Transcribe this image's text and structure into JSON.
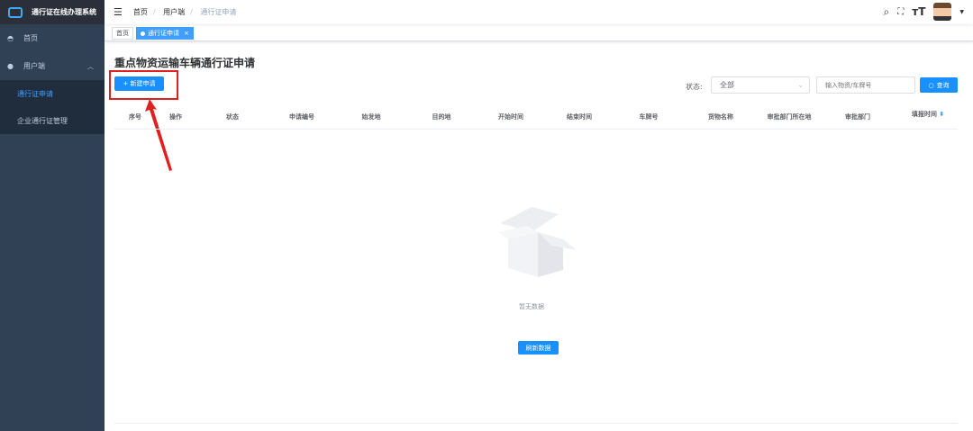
{
  "app": {
    "title": "通行证在线办理系统"
  },
  "sidebar": {
    "items": [
      {
        "label": "首页"
      },
      {
        "label": "用户端",
        "children": [
          {
            "label": "通行证申请",
            "active": true
          },
          {
            "label": "企业通行证管理"
          }
        ]
      }
    ]
  },
  "breadcrumb": [
    "首页",
    "用户端",
    "通行证申请"
  ],
  "tags": [
    {
      "label": "首页"
    },
    {
      "label": "通行证申请",
      "close": "×"
    }
  ],
  "page": {
    "title": "重点物资运输车辆通行证申请",
    "new_button": "+ 新建申请"
  },
  "filter": {
    "status_label": "状态:",
    "status_value": "全部",
    "search_placeholder": "输入物资/车牌号",
    "query_button": "查询"
  },
  "table": {
    "columns": [
      "序号",
      "操作",
      "状态",
      "申请编号",
      "始发地",
      "目的地",
      "开始时间",
      "结束时间",
      "车牌号",
      "货物名称",
      "审批部门所在地",
      "审批部门",
      "填报时间"
    ],
    "rows": []
  },
  "empty": {
    "text": "暂无数据",
    "refresh_button": "刷新数据"
  },
  "colors": {
    "primary": "#1890ff",
    "sidebar": "#304156",
    "highlight": "#e02020"
  }
}
